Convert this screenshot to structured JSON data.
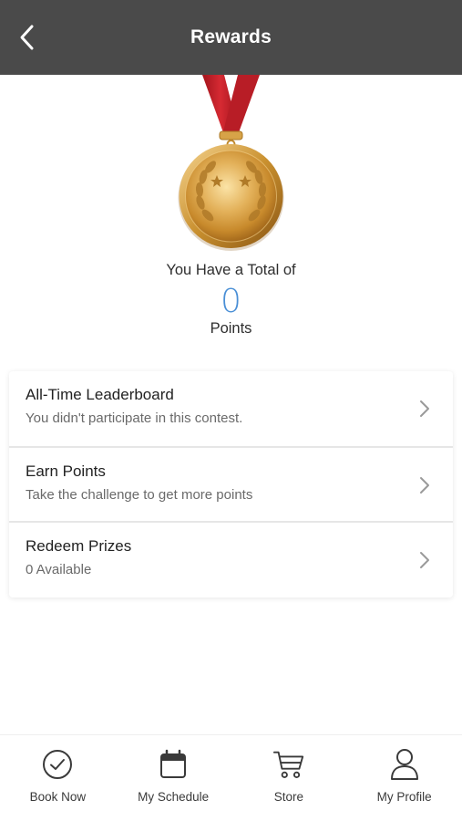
{
  "header": {
    "title": "Rewards",
    "back_icon": "chevron-left-icon"
  },
  "summary": {
    "total_label": "You Have a Total of",
    "points": "0",
    "points_label": "Points",
    "points_color": "#4a8fd6"
  },
  "menu": {
    "items": [
      {
        "title": "All-Time Leaderboard",
        "subtitle": "You didn't participate in this contest.",
        "icon": "chevron-right-icon"
      },
      {
        "title": "Earn Points",
        "subtitle": "Take the challenge to get more points",
        "icon": "chevron-right-icon"
      },
      {
        "title": "Redeem Prizes",
        "subtitle": "0 Available",
        "icon": "chevron-right-icon"
      }
    ]
  },
  "nav": {
    "items": [
      {
        "label": "Book Now",
        "icon": "check-circle-icon"
      },
      {
        "label": "My Schedule",
        "icon": "calendar-icon"
      },
      {
        "label": "Store",
        "icon": "cart-icon"
      },
      {
        "label": "My Profile",
        "icon": "user-icon"
      }
    ]
  },
  "colors": {
    "header_bg": "#4a4a4a",
    "ribbon": "#c8202a",
    "medal_gold": "#d9a441"
  }
}
